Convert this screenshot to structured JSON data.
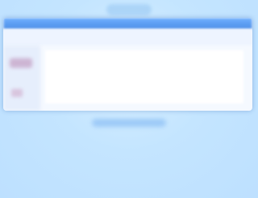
{
  "colors": {
    "background": "#bde0ff",
    "window_header": "#4d8fe8",
    "window_body": "#f5f9ff",
    "accent_thumb": "#c7a7c9"
  },
  "icons": {
    "top_tab": "tab-shape",
    "left_thumbnail": "image-icon",
    "left_small_thumbnail": "image-icon"
  }
}
